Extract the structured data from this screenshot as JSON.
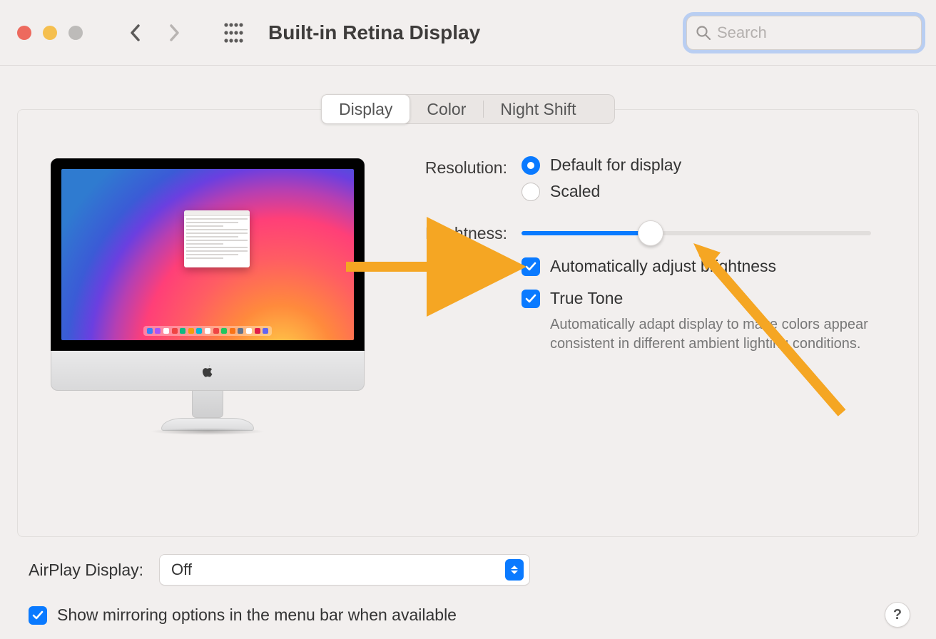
{
  "header": {
    "title": "Built-in Retina Display",
    "search_placeholder": "Search"
  },
  "tabs": {
    "display": "Display",
    "color": "Color",
    "night_shift": "Night Shift",
    "active": "display"
  },
  "resolution": {
    "label": "Resolution:",
    "options": {
      "default": "Default for display",
      "scaled": "Scaled"
    },
    "selected": "default"
  },
  "brightness": {
    "label": "Brightness:",
    "value_percent": 37,
    "auto_adjust_label": "Automatically adjust brightness",
    "auto_adjust_checked": true
  },
  "true_tone": {
    "label": "True Tone",
    "checked": true,
    "help": "Automatically adapt display to make colors appear consistent in different ambient lighting conditions."
  },
  "airplay": {
    "label": "AirPlay Display:",
    "value": "Off"
  },
  "mirroring": {
    "label": "Show mirroring options in the menu bar when available",
    "checked": true
  },
  "help_button": "?"
}
